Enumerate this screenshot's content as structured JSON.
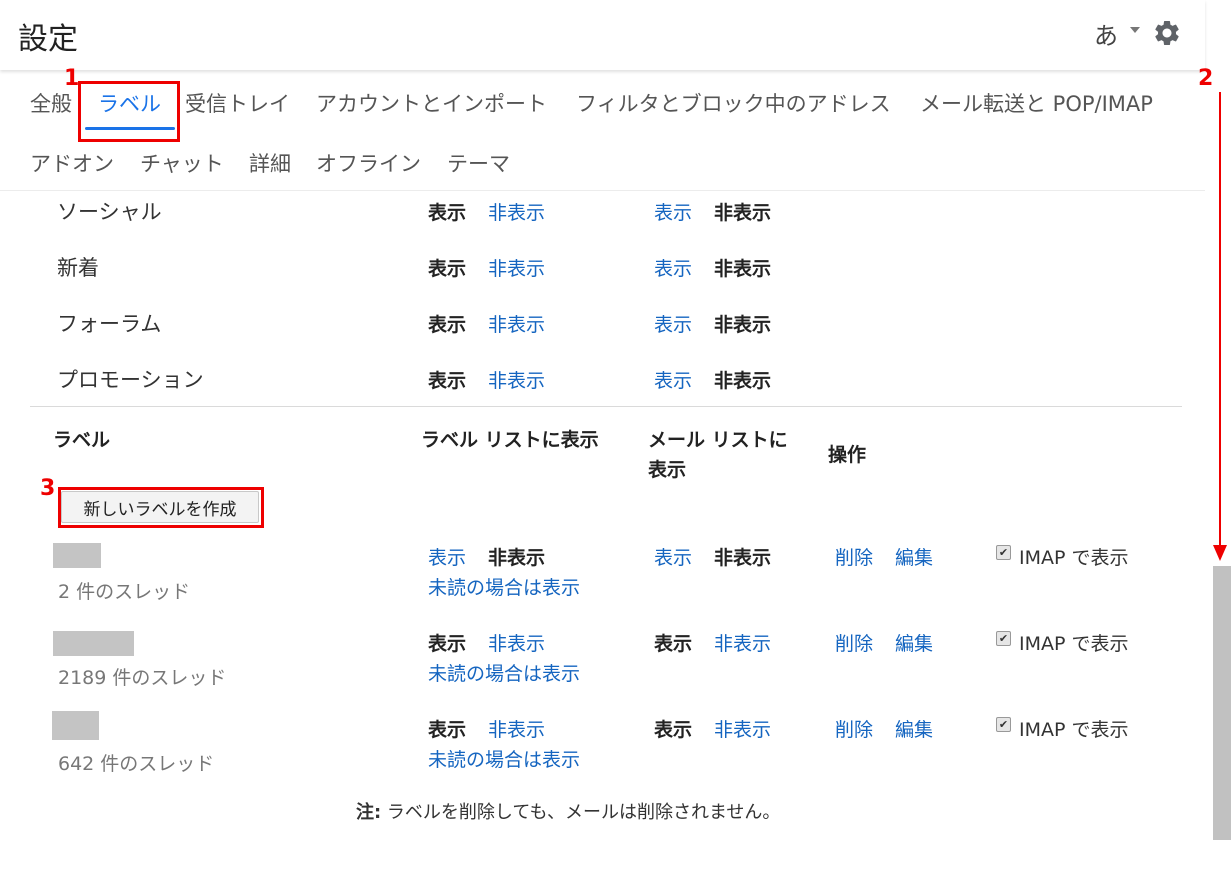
{
  "header": {
    "title": "設定",
    "lang": "あ"
  },
  "tabs": [
    "全般",
    "ラベル",
    "受信トレイ",
    "アカウントとインポート",
    "フィルタとブロック中のアドレス",
    "メール転送と POP/IMAP",
    "アドオン",
    "チャット",
    "詳細",
    "オフライン",
    "テーマ"
  ],
  "show": "表示",
  "hide": "非表示",
  "categories": [
    {
      "name": "ソーシャル"
    },
    {
      "name": "新着"
    },
    {
      "name": "フォーラム"
    },
    {
      "name": "プロモーション"
    }
  ],
  "label_header": {
    "label": "ラベル",
    "show_in_label_list": "ラベル リストに表示",
    "show_in_message_list": "メール リストに表示",
    "actions": "操作"
  },
  "create_button": "新しいラベルを作成",
  "labels": [
    {
      "threads": "2 件のスレッド",
      "label_list": "非表示",
      "message_list": "非表示",
      "unread_option": "未読の場合は表示"
    },
    {
      "threads": "2189 件のスレッド",
      "label_list": "表示",
      "message_list": "表示",
      "unread_option": "未読の場合は表示"
    },
    {
      "threads": "642 件のスレッド",
      "label_list": "表示",
      "message_list": "表示",
      "unread_option": "未読の場合は表示"
    }
  ],
  "actions": {
    "delete": "削除",
    "edit": "編集",
    "imap": "IMAP で表示"
  },
  "note": {
    "bold": "注:",
    "text": " ラベルを削除しても、メールは削除されません。"
  },
  "annotations": [
    "1",
    "2",
    "3"
  ],
  "colors": {
    "link": "#1565c0",
    "active_tab": "#1a73e8",
    "annotation": "#e00000"
  }
}
